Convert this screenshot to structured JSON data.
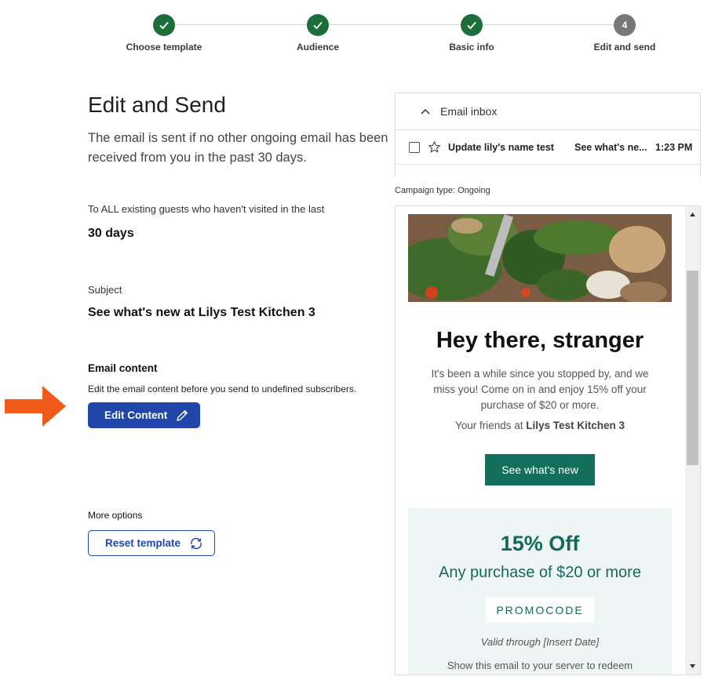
{
  "stepper": {
    "steps": [
      {
        "label": "Choose template",
        "status": "done"
      },
      {
        "label": "Audience",
        "status": "done"
      },
      {
        "label": "Basic info",
        "status": "done"
      },
      {
        "label": "Edit and send",
        "status": "current",
        "number": "4"
      }
    ]
  },
  "page": {
    "title": "Edit and Send",
    "description": "The email is sent if no other ongoing email has been received from you in the past 30 days."
  },
  "audience": {
    "label": "To ALL existing guests who haven't visited in the last",
    "value": "30 days"
  },
  "subject": {
    "label": "Subject",
    "value": "See what's new at Lilys Test Kitchen 3"
  },
  "email_content": {
    "heading": "Email content",
    "description": "Edit the email content before you send to undefined subscribers.",
    "edit_button": "Edit Content"
  },
  "more_options": {
    "heading": "More options",
    "reset_button": "Reset template"
  },
  "inbox": {
    "title": "Email inbox",
    "row": {
      "sender": "Update lily's name test",
      "subject": "See what's ne...",
      "time": "1:23 PM"
    }
  },
  "campaign": {
    "label": "Campaign type:",
    "value": "Ongoing"
  },
  "email_preview": {
    "greeting": "Hey there, stranger",
    "body": "It's been a while since you stopped by, and we miss you! Come on in and enjoy 15% off your purchase of $20 or more.",
    "sign_prefix": "Your friends at",
    "sign_name": "Lilys Test Kitchen 3",
    "cta": "See what's new",
    "offer_title": "15% Off",
    "offer_sub": "Any purchase of $20 or more",
    "promo": "PROMOCODE",
    "valid": "Valid through [Insert Date]",
    "redeem": "Show this email to your server to redeem"
  },
  "colors": {
    "brand_blue": "#1f46a8",
    "step_done": "#1d6e3a",
    "email_green": "#136f5c",
    "arrow": "#f05a1a"
  }
}
